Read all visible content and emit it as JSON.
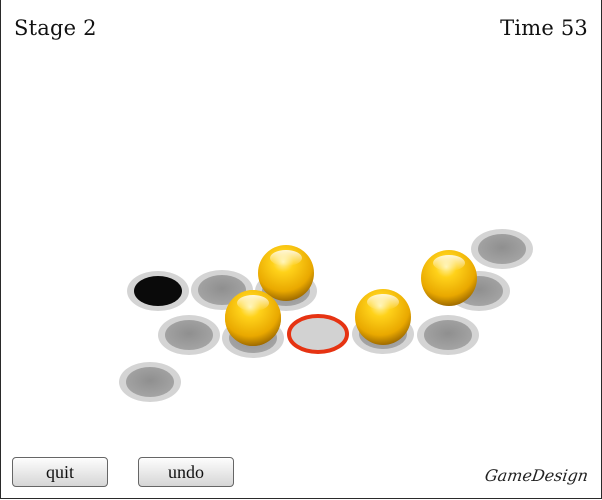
{
  "hud": {
    "stage": "Stage 2",
    "time": "Time 53"
  },
  "buttons": {
    "quit": "quit",
    "undo": "undo"
  },
  "logo": "GameDesign",
  "colors": {
    "hole_empty": "#9a9a9a",
    "hole_rim": "#d4d4d4",
    "hole_target": "#0a0a0a",
    "hole_selected": "#e63312",
    "ball": "#f1b600"
  },
  "board": {
    "holes": [
      {
        "id": "a1",
        "state": "empty"
      },
      {
        "id": "a2",
        "state": "target"
      },
      {
        "id": "a3",
        "state": "empty"
      },
      {
        "id": "a4",
        "state": "occupied"
      },
      {
        "id": "a5",
        "state": "empty"
      },
      {
        "id": "a6",
        "state": "occupied"
      },
      {
        "id": "a7",
        "state": "occupied"
      },
      {
        "id": "a8",
        "state": "selected"
      },
      {
        "id": "a9",
        "state": "occupied"
      },
      {
        "id": "a10",
        "state": "empty"
      },
      {
        "id": "a11",
        "state": "occupied"
      },
      {
        "id": "a12",
        "state": "empty"
      }
    ]
  }
}
